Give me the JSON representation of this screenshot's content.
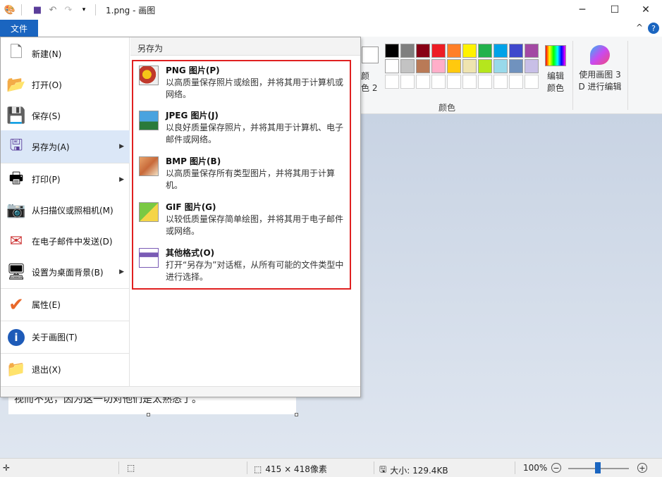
{
  "window": {
    "title": "1.png - 画图",
    "minimize": "─",
    "maximize": "☐",
    "close": "✕"
  },
  "ribbon": {
    "file_tab": "文件",
    "collapse": "^",
    "help": "?",
    "color1_label_line1": "颜",
    "color1_label_line2": "色 2",
    "edit_colors_line1": "编辑",
    "edit_colors_line2": "颜色",
    "paint3d_line1": "使用画图 3",
    "paint3d_line2": "D 进行编辑",
    "colors_group": "颜色",
    "palette": [
      "#000000",
      "#7f7f7f",
      "#880015",
      "#ed1c24",
      "#ff7f27",
      "#fff200",
      "#22b14c",
      "#00a2e8",
      "#3f48cc",
      "#a349a4",
      "#ffffff",
      "#c3c3c3",
      "#b97a57",
      "#ffaec9",
      "#ffc90e",
      "#efe4b0",
      "#b5e61d",
      "#99d9ea",
      "#7092be",
      "#c8bfe7",
      "#ffffff",
      "#ffffff",
      "#ffffff",
      "#ffffff",
      "#ffffff",
      "#ffffff",
      "#ffffff",
      "#ffffff",
      "#ffffff",
      "#ffffff"
    ]
  },
  "canvas": {
    "visible_text": "视而不见，因为这一切对他们是太熟悉了。"
  },
  "file_menu": {
    "items": [
      {
        "label": "新建(N)",
        "icon": "new-file-icon"
      },
      {
        "label": "打开(O)",
        "icon": "open-folder-icon"
      },
      {
        "label": "保存(S)",
        "icon": "save-icon"
      },
      {
        "label": "另存为(A)",
        "icon": "save-as-icon"
      },
      {
        "label": "打印(P)",
        "icon": "printer-icon"
      },
      {
        "label": "从扫描仪或照相机(M)",
        "icon": "scanner-icon"
      },
      {
        "label": "在电子邮件中发送(D)",
        "icon": "email-icon"
      },
      {
        "label": "设置为桌面背景(B)",
        "icon": "desktop-background-icon"
      },
      {
        "label": "属性(E)",
        "icon": "checkmark-icon"
      },
      {
        "label": "关于画图(T)",
        "icon": "info-icon"
      },
      {
        "label": "退出(X)",
        "icon": "exit-icon"
      }
    ],
    "submenu": {
      "header": "另存为",
      "items": [
        {
          "title": "PNG 图片(P)",
          "desc": "以高质量保存照片或绘图，并将其用于计算机或网络。"
        },
        {
          "title": "JPEG 图片(J)",
          "desc": "以良好质量保存照片，并将其用于计算机、电子邮件或网络。"
        },
        {
          "title": "BMP 图片(B)",
          "desc": "以高质量保存所有类型图片，并将其用于计算机。"
        },
        {
          "title": "GIF 图片(G)",
          "desc": "以较低质量保存简单绘图，并将其用于电子邮件或网络。"
        },
        {
          "title": "其他格式(O)",
          "desc": "打开“另存为”对话框，从所有可能的文件类型中进行选择。"
        }
      ]
    }
  },
  "status": {
    "dimensions": "415 × 418像素",
    "size": "大小: 129.4KB",
    "zoom": "100%",
    "zoom_percent": 100
  }
}
